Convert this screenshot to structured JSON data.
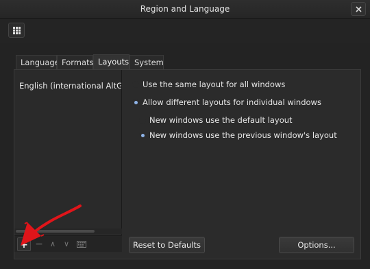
{
  "window": {
    "title": "Region and Language"
  },
  "tabs": [
    {
      "label": "Language"
    },
    {
      "label": "Formats"
    },
    {
      "label": "Layouts"
    },
    {
      "label": "System"
    }
  ],
  "layouts": {
    "items": [
      "English (international AltGr de"
    ]
  },
  "list_toolbar": {
    "add": "+",
    "remove": "−",
    "up": "∧",
    "down": "∨"
  },
  "options": {
    "same_layout": "Use the same layout for all windows",
    "different_layouts": "Allow different layouts for individual windows",
    "new_default": "New windows use the default layout",
    "new_previous": "New windows use the previous window's layout"
  },
  "buttons": {
    "reset": "Reset to Defaults",
    "options": "Options..."
  },
  "colors": {
    "annotation_arrow": "#e0151a",
    "radio_selected": "#8fb4e8"
  }
}
